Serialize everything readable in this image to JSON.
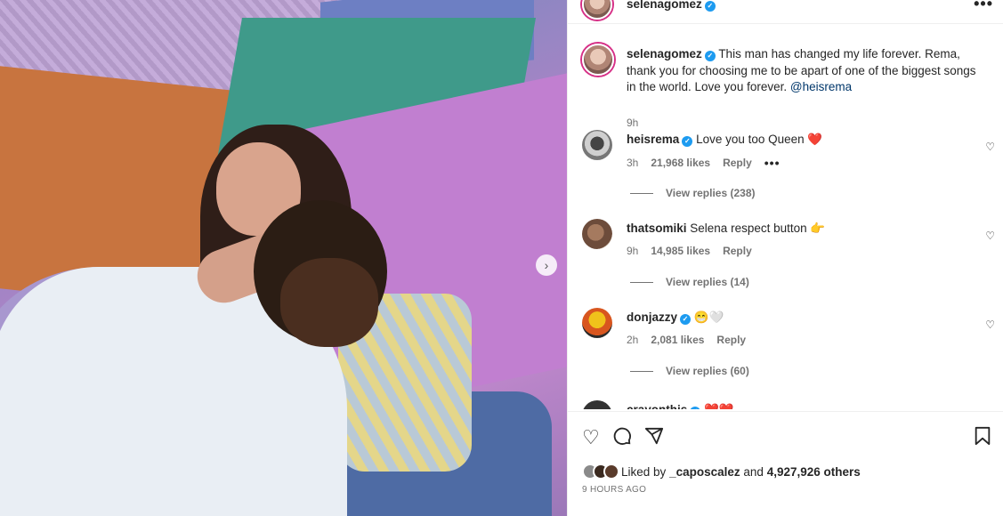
{
  "post": {
    "author": "selenagomez",
    "more_label": "•••",
    "caption": {
      "username": "selenagomez",
      "text": "This man has changed my life forever. Rema, thank you for choosing me to be apart of one of the biggest songs in the world. Love you forever.",
      "mention": "@heisrema",
      "time": "9h"
    }
  },
  "comments": [
    {
      "username": "heisrema",
      "verified": true,
      "text": "Love you too Queen",
      "emoji": "❤️",
      "time": "3h",
      "likes": "21,968 likes",
      "reply": "Reply",
      "more": "•••",
      "replies": "View replies (238)"
    },
    {
      "username": "thatsomiki",
      "verified": false,
      "text": "Selena respect button",
      "emoji": "👉",
      "time": "9h",
      "likes": "14,985 likes",
      "reply": "Reply",
      "replies": "View replies (14)"
    },
    {
      "username": "donjazzy",
      "verified": true,
      "text": "",
      "emoji": "😁🤍",
      "time": "2h",
      "likes": "2,081 likes",
      "reply": "Reply",
      "replies": "View replies (60)"
    },
    {
      "username": "crayonthis",
      "verified": true,
      "text": "",
      "emoji": "❤️❤️"
    }
  ],
  "footer": {
    "liked_by_prefix": "Liked by",
    "liked_by_user": "_caposcalez",
    "and": "and",
    "others": "4,927,926 others",
    "ago": "9 HOURS AGO"
  },
  "icons": {
    "like": "heart-outline-icon",
    "comment": "speech-bubble-icon",
    "share": "paper-plane-icon",
    "save": "bookmark-icon",
    "carousel_next": "chevron-right-icon"
  },
  "colors": {
    "verified": "#1d9bf0",
    "story_ring": "#d62f86",
    "muted": "#737373",
    "mention": "#00376b"
  }
}
